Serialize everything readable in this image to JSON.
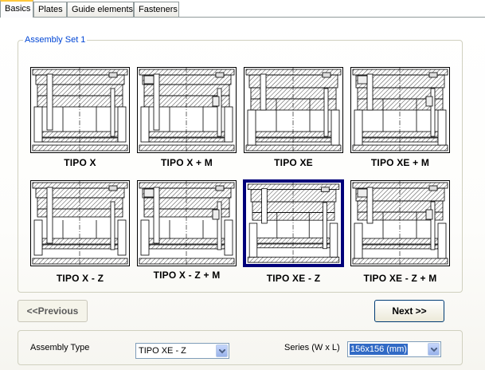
{
  "tabs": [
    "Basics",
    "Plates",
    "Guide elements",
    "Fasteners"
  ],
  "group": {
    "title": "Assembly Set 1",
    "items": [
      {
        "label": "TIPO X",
        "variant": "x",
        "selected": false
      },
      {
        "label": "TIPO X + M",
        "variant": "xm",
        "selected": false
      },
      {
        "label": "TIPO XE",
        "variant": "xe",
        "selected": false
      },
      {
        "label": "TIPO XE + M",
        "variant": "xem",
        "selected": false
      },
      {
        "label": "TIPO X - Z",
        "variant": "xz",
        "selected": false
      },
      {
        "label": "TIPO X - Z + M",
        "variant": "xzm",
        "selected": false
      },
      {
        "label": "TIPO XE - Z",
        "variant": "xez",
        "selected": true
      },
      {
        "label": "TIPO XE - Z + M",
        "variant": "xezm",
        "selected": false
      }
    ]
  },
  "nav": {
    "previous": "<<Previous",
    "next": "Next >>"
  },
  "bottom": {
    "assembly_type_label": "Assembly Type",
    "assembly_type_value": "TIPO XE - Z",
    "series_label": "Series (W x L)",
    "series_value": "156x156 (mm)"
  },
  "colors": {
    "selected_border": "#00007a",
    "tab_highlight": "#ffc83c",
    "group_title": "#0046d5"
  }
}
